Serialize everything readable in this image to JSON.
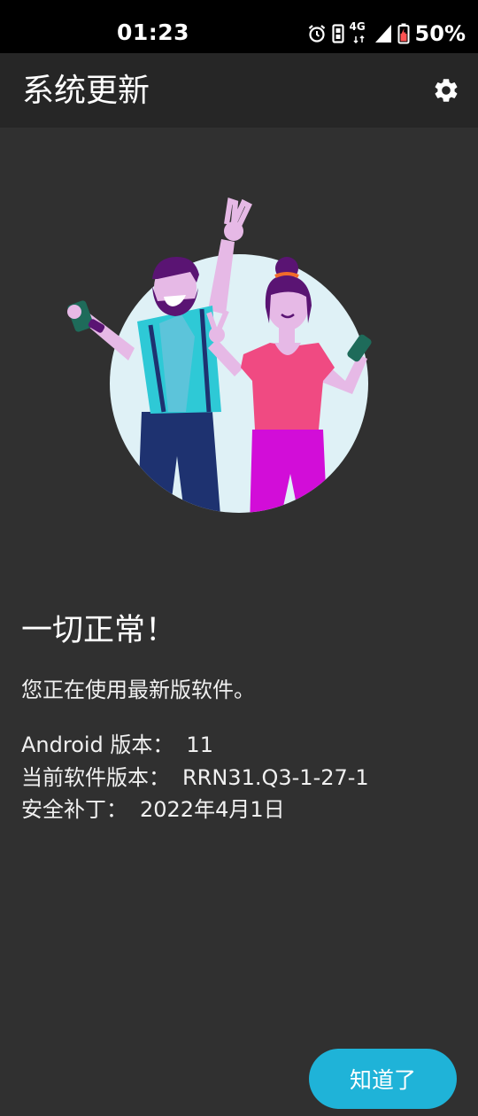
{
  "status_bar": {
    "time": "01:23",
    "network": "4G",
    "battery": "50%",
    "icons": [
      "alarm-icon",
      "sim-icon",
      "signal-icon",
      "battery-icon"
    ]
  },
  "app_bar": {
    "title": "系统更新",
    "settings_icon": "gear-icon"
  },
  "content": {
    "headline": "一切正常！",
    "message": "您正在使用最新版软件。",
    "info": [
      {
        "label": "Android 版本：",
        "value": "11"
      },
      {
        "label": "当前软件版本：",
        "value": "RRN31.Q3-1-27-1"
      },
      {
        "label": "安全补丁：",
        "value": "2022年4月1日"
      }
    ]
  },
  "actions": {
    "got_it_label": "知道了"
  },
  "colors": {
    "background": "#303030",
    "app_bar": "#262626",
    "accent": "#1fb3d8",
    "illustration_circle": "#dff1f6"
  }
}
